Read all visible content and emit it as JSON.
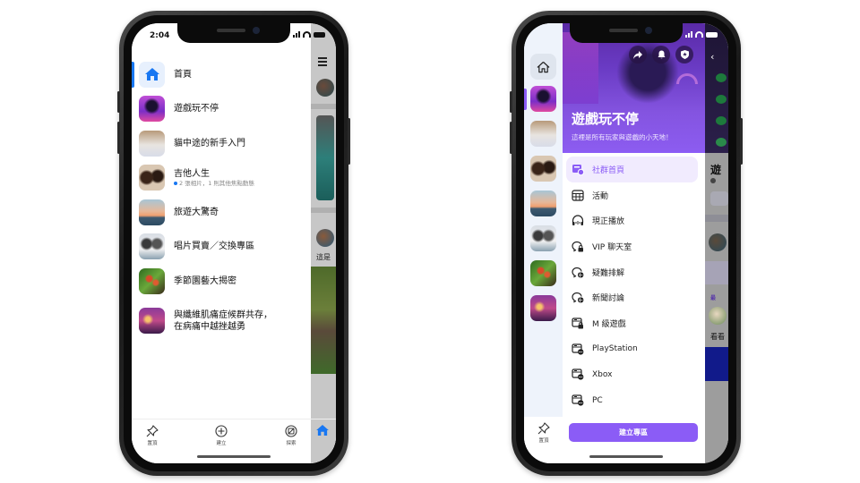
{
  "left_phone": {
    "status": {
      "time": "2:04"
    },
    "menu": [
      {
        "label": "首頁",
        "icon": "home-icon",
        "active": true
      },
      {
        "label": "遊戲玩不停",
        "thumb": "gaming-thumb"
      },
      {
        "label": "貓中途的新手入門",
        "thumb": "cats-thumb"
      },
      {
        "label": "吉他人生",
        "thumb": "guitar-thumb",
        "subtitle": "2 張相片，1 則其他焦點動態",
        "has_unread_dot": true
      },
      {
        "label": "旅遊大驚奇",
        "thumb": "travel-thumb"
      },
      {
        "label": "唱片買賣／交換專區",
        "thumb": "records-thumb"
      },
      {
        "label": "季節園藝大揭密",
        "thumb": "garden-thumb"
      },
      {
        "label": "與纖維肌痛症候群共存，\n在病痛中越挫越勇",
        "thumb": "fibro-thumb"
      }
    ],
    "tabbar": [
      {
        "label": "置頂",
        "icon": "pin-icon"
      },
      {
        "label": "建立",
        "icon": "plus-circle-icon"
      },
      {
        "label": "探索",
        "icon": "explore-icon"
      }
    ],
    "peek": {
      "menu_icon": "hamburger-icon",
      "snippet": "這是"
    }
  },
  "right_phone": {
    "hero": {
      "title": "遊戲玩不停",
      "subtitle": "這裡是所有玩家與遊戲的小天地！",
      "actions": [
        "share-icon",
        "bell-icon",
        "shield-star-icon"
      ]
    },
    "menu": [
      {
        "label": "社群首頁",
        "icon": "community-home-icon",
        "active": true
      },
      {
        "label": "活動",
        "icon": "calendar-grid-icon"
      },
      {
        "label": "現正播放",
        "icon": "headphones-icon"
      },
      {
        "label": "VIP 聊天室",
        "icon": "chat-lock-icon"
      },
      {
        "label": "疑難排解",
        "icon": "chat-globe-icon"
      },
      {
        "label": "新聞討論",
        "icon": "chat-globe-icon"
      },
      {
        "label": "M 級遊戲",
        "icon": "window-lock-icon"
      },
      {
        "label": "PlayStation",
        "icon": "window-globe-icon"
      },
      {
        "label": "Xbox",
        "icon": "window-globe-icon"
      },
      {
        "label": "PC",
        "icon": "window-globe-icon"
      }
    ],
    "create_button": "建立專區",
    "rail_tab": {
      "label": "置頂",
      "icon": "pin-icon"
    },
    "peek": {
      "title_char": "遊",
      "tag1": "最",
      "caption": "看看"
    }
  },
  "colors": {
    "facebook_blue": "#1877f2",
    "accent_purple": "#8b5cf6",
    "active_bg": "#f1ebfe"
  }
}
